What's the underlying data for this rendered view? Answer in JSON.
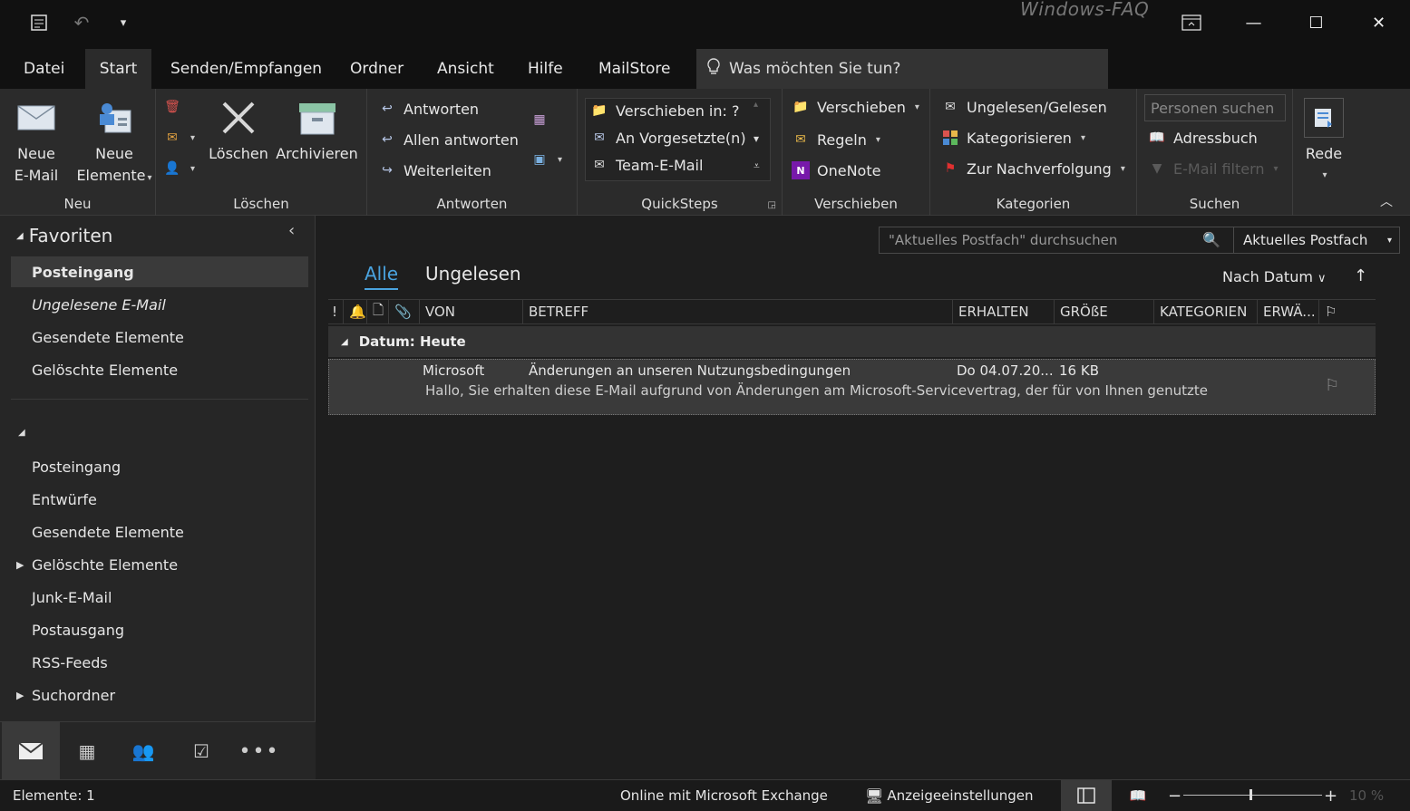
{
  "titlebar": {
    "title": "Windows-FAQ",
    "qat": [
      {
        "icon": "send-receive-icon"
      },
      {
        "icon": "undo-icon"
      },
      {
        "icon": "customize-qat-icon"
      }
    ]
  },
  "tabs": [
    {
      "label": "Datei"
    },
    {
      "label": "Start"
    },
    {
      "label": "Senden/Empfangen"
    },
    {
      "label": "Ordner"
    },
    {
      "label": "Ansicht"
    },
    {
      "label": "Hilfe"
    },
    {
      "label": "MailStore"
    }
  ],
  "tellme": {
    "text": "Was möchten Sie tun?"
  },
  "ribbon": {
    "neu": {
      "label": "Neu",
      "new_email": "Neue E-Mail",
      "new_items_1": "Neue",
      "new_items_2": "Elemente"
    },
    "loeschen": {
      "label": "Löschen",
      "delete": "Löschen",
      "archive": "Archivieren"
    },
    "antworten": {
      "label": "Antworten",
      "reply": "Antworten",
      "reply_all": "Allen antworten",
      "forward": "Weiterleiten"
    },
    "quicksteps": {
      "label": "QuickSteps",
      "items": [
        "Verschieben in: ?",
        "An Vorgesetzte(n)",
        "Team-E-Mail"
      ]
    },
    "verschieben": {
      "label": "Verschieben",
      "move": "Verschieben",
      "rules": "Regeln",
      "onenote": "OneNote"
    },
    "kategorien": {
      "label": "Kategorien",
      "unread_read": "Ungelesen/Gelesen",
      "categorize": "Kategorisieren",
      "followup": "Zur Nachverfolgung"
    },
    "suchen": {
      "label": "Suchen",
      "people_placeholder": "Personen suchen",
      "addressbook": "Adressbuch",
      "filter": "E-Mail filtern"
    },
    "rede": {
      "label": "Rede"
    }
  },
  "nav": {
    "favorites_title": "Favoriten",
    "favorites": [
      "Posteingang",
      "Ungelesene E-Mail",
      "Gesendete Elemente",
      "Gelöschte Elemente"
    ],
    "folders": [
      "Posteingang",
      "Entwürfe",
      "Gesendete Elemente",
      "Gelöschte Elemente",
      "Junk-E-Mail",
      "Postausgang",
      "RSS-Feeds",
      "Suchordner"
    ]
  },
  "main": {
    "search_placeholder": "\"Aktuelles Postfach\" durchsuchen",
    "scope": "Aktuelles Postfach",
    "filters": [
      "Alle",
      "Ungelesen"
    ],
    "sort": "Nach Datum",
    "columns": {
      "from": "VON",
      "subject": "BETREFF",
      "received": "ERHALTEN",
      "size": "GRÖßE",
      "categories": "KATEGORIEN",
      "mention": "ERWÄ..."
    },
    "group": "Datum: Heute",
    "mail": {
      "from": "Microsoft",
      "subject": "Änderungen an unseren Nutzungsbedingungen",
      "received": "Do 04.07.20...",
      "size": "16 KB",
      "preview": "Hallo,  Sie erhalten diese E-Mail aufgrund von Änderungen am Microsoft-Servicevertrag, der für von Ihnen genutzte"
    }
  },
  "status": {
    "items": "Elemente: 1",
    "connection": "Online mit Microsoft Exchange",
    "display_settings": "Anzeigeeinstellungen",
    "zoom": "10 %"
  },
  "colors": {
    "accent": "#4aa3df",
    "background": "#1e1e1e",
    "ribbon": "#2b2b2b"
  }
}
